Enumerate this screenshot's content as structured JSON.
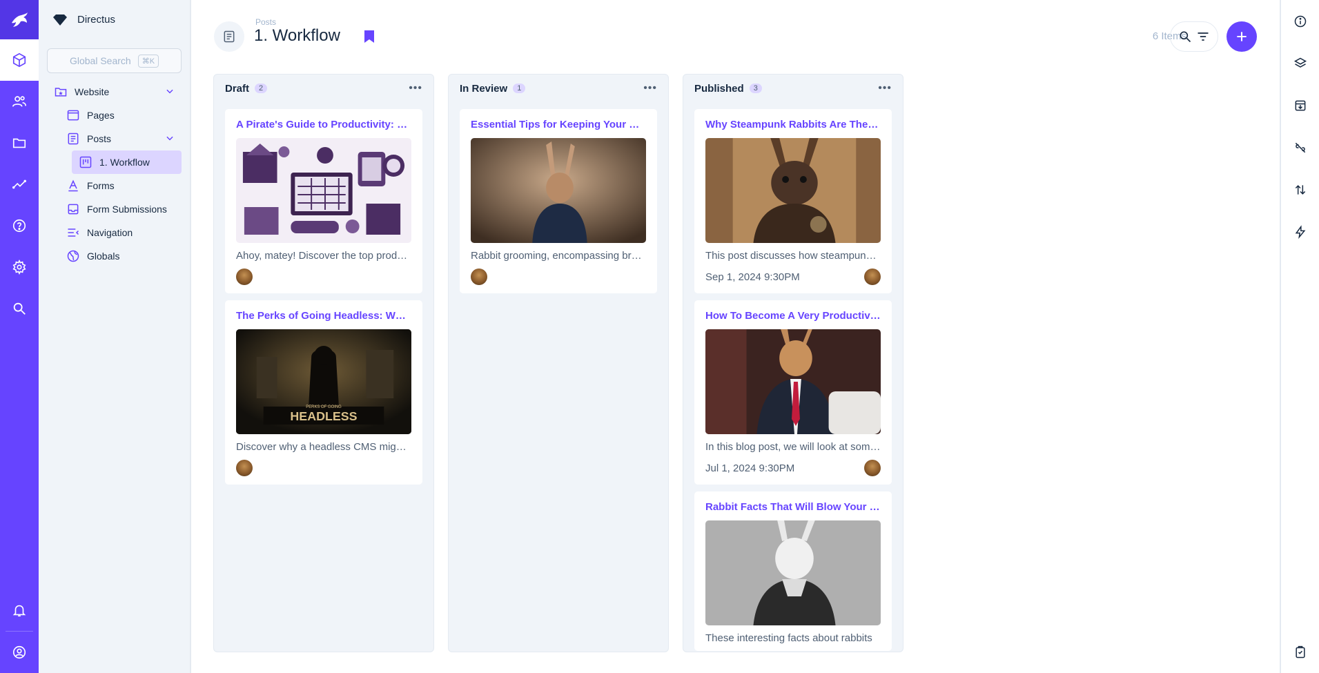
{
  "app": {
    "project_name": "Directus"
  },
  "nav": {
    "search_placeholder": "Global Search",
    "search_shortcut": "⌘K",
    "items": [
      {
        "label": "Website"
      },
      {
        "label": "Pages"
      },
      {
        "label": "Posts"
      },
      {
        "label": "1. Workflow"
      },
      {
        "label": "Forms"
      },
      {
        "label": "Form Submissions"
      },
      {
        "label": "Navigation"
      },
      {
        "label": "Globals"
      }
    ]
  },
  "header": {
    "breadcrumb": "Posts",
    "title": "1. Workflow",
    "item_count": "6 Items"
  },
  "columns": [
    {
      "title": "Draft",
      "count": "2",
      "cards": [
        {
          "title": "A Pirate's Guide to Productivity: Working Smarter on the High Seas",
          "description": "Ahoy, matey! Discover the top productivity tips",
          "image": "pirate-productivity"
        },
        {
          "title": "The Perks of Going Headless: Why a headless CMS",
          "description": "Discover why a headless CMS might be right",
          "image": "headless"
        }
      ]
    },
    {
      "title": "In Review",
      "count": "1",
      "cards": [
        {
          "title": "Essential Tips for Keeping Your Bunny Clean",
          "description": "Rabbit grooming, encompassing brushing and more",
          "image": "rabbit-hoodie"
        }
      ]
    },
    {
      "title": "Published",
      "count": "3",
      "cards": [
        {
          "title": "Why Steampunk Rabbits Are The Future",
          "description": "This post discusses how steampunk rabbits",
          "date": "Sep 1, 2024 9:30PM",
          "image": "steampunk-rabbit"
        },
        {
          "title": "How To Become A Very Productive Rabbit",
          "description": "In this blog post, we will look at some tips",
          "date": "Jul 1, 2024 9:30PM",
          "image": "rabbit-suit"
        },
        {
          "title": "Rabbit Facts That Will Blow Your Mind",
          "description": "These interesting facts about rabbits",
          "image": "rabbit-sketch"
        }
      ]
    }
  ],
  "colors": {
    "accent": "#6644ff",
    "module_bg": "#6644ff",
    "nav_bg": "#f0f4f9"
  },
  "icons": {
    "module_bar": [
      "directus-logo-icon",
      "content-box-icon",
      "users-icon",
      "files-folder-icon",
      "insights-icon",
      "help-icon",
      "settings-gear-icon",
      "search-icon",
      "notifications-bell-icon",
      "account-icon"
    ],
    "sidebar": [
      "info-icon",
      "layers-icon",
      "archive-icon",
      "link-off-icon",
      "import-export-icon",
      "flows-bolt-icon",
      "clipboard-icon"
    ]
  }
}
